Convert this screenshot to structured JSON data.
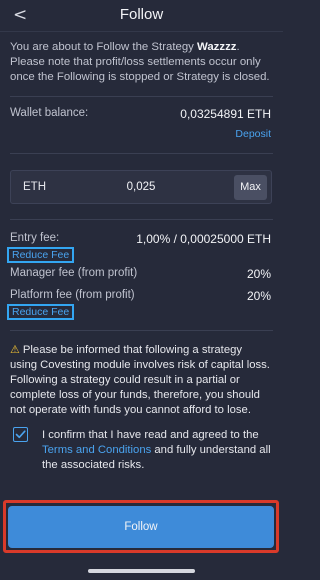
{
  "header": {
    "back_glyph": "<",
    "title": "Follow"
  },
  "notice": {
    "text_before": "You are about to Follow the Strategy ",
    "strategy_name": "Wazzzz",
    "text_after": ". Please note that profit/loss settlements occur only once the Following is stopped or Strategy is closed."
  },
  "wallet": {
    "label": "Wallet balance:",
    "value": "0,03254891 ETH",
    "deposit_label": "Deposit"
  },
  "amount": {
    "currency": "ETH",
    "value": "0,025",
    "max_label": "Max"
  },
  "fees": {
    "entry_label": "Entry fee:",
    "entry_value": "1,00% / 0,00025000 ETH",
    "reduce_fee_label_1": "Reduce Fee",
    "manager_label": "Manager fee (from profit)",
    "manager_value": "20%",
    "platform_label": "Platform fee (from profit)",
    "platform_value": "20%",
    "reduce_fee_label_2": "Reduce Fee"
  },
  "warning": {
    "icon": "warning-icon",
    "text": "Please be informed that following a strategy using Covesting module involves risk of capital loss. Following a strategy could result in a partial or complete loss of your funds, therefore, you should not operate with funds you cannot afford to lose."
  },
  "confirm": {
    "checked": true,
    "text_before": "I confirm that I have read and agreed to the ",
    "link": "Terms and Conditions",
    "text_after": " and fully understand all the associated risks."
  },
  "follow_button": {
    "label": "Follow"
  },
  "colors": {
    "background": "#262a3a",
    "accent": "#4aa3ef",
    "button": "#3e8bd9",
    "highlight": "#d93a2a",
    "warning": "#f2c233"
  }
}
